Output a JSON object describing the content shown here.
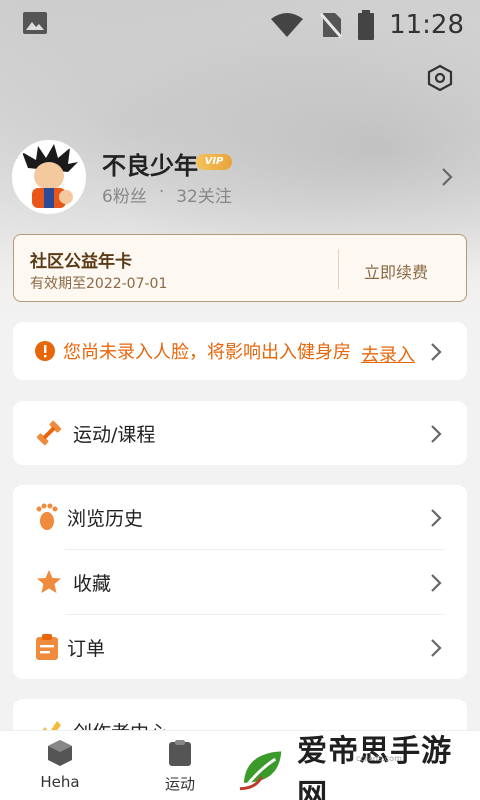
{
  "status_bar": {
    "time": "11:28"
  },
  "profile": {
    "username": "不良少年",
    "vip_badge": "VIP",
    "fans": "6粉丝",
    "separator": "·",
    "following": "32关注"
  },
  "membership": {
    "title": "社区公益年卡",
    "valid_until": "有效期至2022-07-01",
    "renew": "立即续费"
  },
  "face_notice": {
    "text": "您尚未录入人脸，将影响出入健身房",
    "action": "去录入"
  },
  "menu_sport": {
    "label": "运动/课程"
  },
  "menu_group": {
    "items": [
      {
        "label": "浏览历史"
      },
      {
        "label": "收藏"
      },
      {
        "label": "订单"
      }
    ]
  },
  "menu_creator": {
    "label": "创作者中心"
  },
  "bottom_nav": {
    "items": [
      {
        "label": "Heha"
      },
      {
        "label": "运动"
      }
    ]
  },
  "watermark": {
    "text": "爱帝思手游网",
    "url": "ccrads.com"
  },
  "colors": {
    "accent_orange": "#e8660a",
    "gold_text": "#5b3a17",
    "card_border": "#b89a74"
  }
}
